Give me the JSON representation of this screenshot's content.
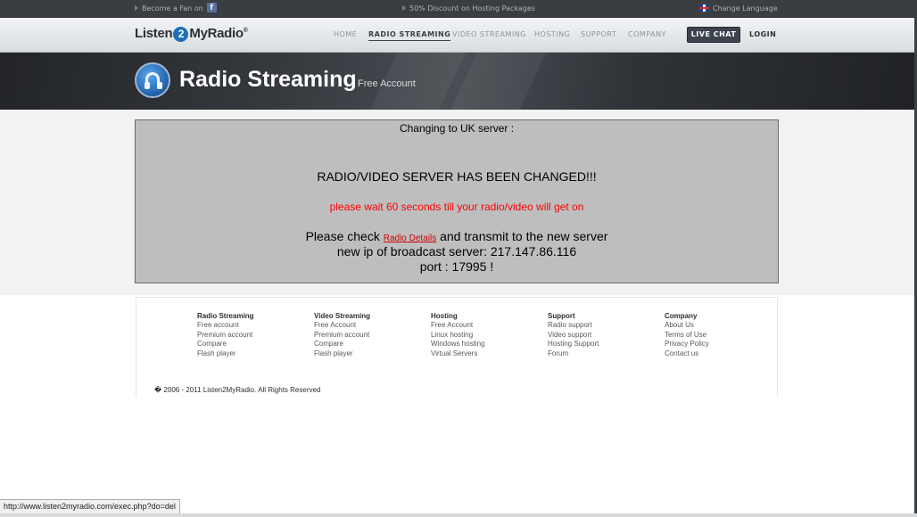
{
  "topbar": {
    "fan_text": "Become a Fan on",
    "fb_icon": "f",
    "discount_text": "50% Discount on Hosting Packages",
    "language_text": "Change Language"
  },
  "nav": {
    "logo_left": "Listen",
    "logo_num": "2",
    "logo_right": "MyRadio",
    "logo_mark": "®",
    "links": [
      {
        "label": "HOME"
      },
      {
        "label": "RADIO STREAMING"
      },
      {
        "label": "VIDEO STREAMING"
      },
      {
        "label": "HOSTING"
      },
      {
        "label": "SUPPORT"
      },
      {
        "label": "COMPANY"
      }
    ],
    "live_chat": "LIVE CHAT",
    "login": "LOGIN"
  },
  "banner": {
    "title": "Radio Streaming",
    "subtitle": "Free Account"
  },
  "message": {
    "line1": "Changing to UK server :",
    "line2": "RADIO/VIDEO SERVER HAS BEEN CHANGED!!!",
    "line3": "please wait 60 seconds till your radio/video will get on",
    "line4_pre": "Please check",
    "line4_link": "Radio Details",
    "line4_post": "and transmit to the new server",
    "line5": "new ip of broadcast server: 217.147.86.116",
    "line6": "port : 17995 !"
  },
  "footer": {
    "columns": [
      {
        "heading": "Radio Streaming",
        "items": [
          "Free account",
          "Premium account",
          "Compare",
          "Flash player"
        ]
      },
      {
        "heading": "Video Streaming",
        "items": [
          "Free Account",
          "Premium account",
          "Compare",
          "Flash player"
        ]
      },
      {
        "heading": "Hosting",
        "items": [
          "Free Account",
          "Linux hosting",
          "Windows hosting",
          "Virtual Servers"
        ]
      },
      {
        "heading": "Support",
        "items": [
          "Radio support",
          "Video support",
          "Hosting Support",
          "Forum"
        ]
      },
      {
        "heading": "Company",
        "items": [
          "About Us",
          "Terms of Use",
          "Privacy Policy",
          "Contact us"
        ]
      }
    ],
    "copyright": "� 2006 - 2011 Listen2MyRadio. All Rights Reserved"
  },
  "statusbar": {
    "url": "http://www.listen2myradio.com/exec.php?do=del"
  },
  "colors": {
    "accent_blue": "#1f6fb8",
    "alert_red": "#ff0000",
    "message_bg": "#bebebe"
  }
}
